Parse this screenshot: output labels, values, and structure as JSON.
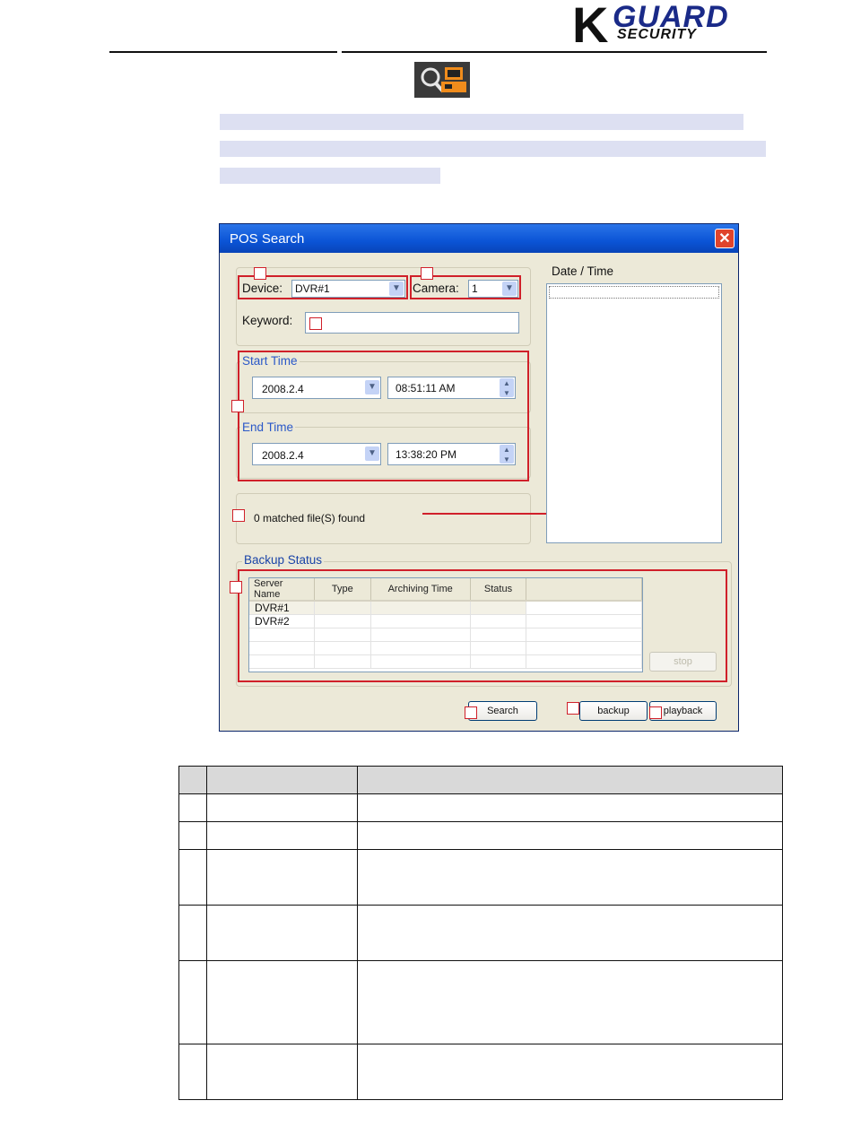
{
  "header": {
    "logo_k": "K",
    "logo_guard": "GUARD",
    "logo_security": "SECURITY"
  },
  "dialog": {
    "title": "POS Search",
    "close_glyph": "✕",
    "device_label": "Device:",
    "device_value": "DVR#1",
    "camera_label": "Camera:",
    "camera_value": "1",
    "keyword_label": "Keyword:",
    "start_time_label": "Start Time",
    "start_date": "2008.2.4",
    "start_time": "08:51:11 AM",
    "end_time_label": "End Time",
    "end_date": "2008.2.4",
    "end_time": "13:38:20 PM",
    "matched_text": "0 matched file(S) found",
    "date_time_label": "Date / Time",
    "backup_status_label": "Backup Status",
    "backup_columns": [
      "Server Name",
      "Type",
      "Archiving Time",
      "Status",
      ""
    ],
    "backup_rows": [
      [
        "DVR#1",
        "",
        "",
        "",
        ""
      ],
      [
        "DVR#2",
        "",
        "",
        "",
        ""
      ],
      [
        "",
        "",
        "",
        "",
        ""
      ],
      [
        "",
        "",
        "",
        "",
        ""
      ],
      [
        "",
        "",
        "",
        "",
        ""
      ]
    ],
    "stop_label": "stop",
    "search_label": "Search",
    "backup_label": "backup",
    "playback_label": "playback"
  },
  "colors": {
    "callout_red": "#d0202a",
    "title_blue": "#0b54d6",
    "dialog_bg": "#ece9d8"
  },
  "icons": {
    "toolbar_icon": "pos-search-icon"
  }
}
